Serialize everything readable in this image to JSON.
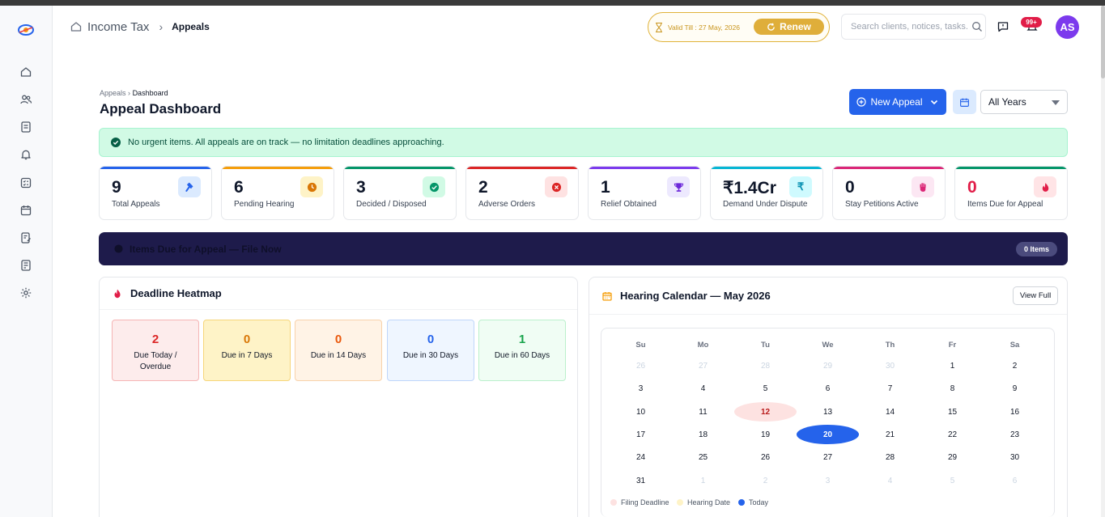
{
  "header": {
    "module": "Income Tax",
    "page": "Appeals",
    "validity": "Valid Till : 27 May, 2026",
    "renew_label": "Renew",
    "search_placeholder": "Search clients, notices, tasks...",
    "notification_count": "99+",
    "avatar_initials": "AS"
  },
  "page": {
    "breadcrumb_parent": "Appeals",
    "breadcrumb_current": "Dashboard",
    "title": "Appeal Dashboard",
    "new_appeal_label": "New Appeal",
    "year_filter": "All Years"
  },
  "alert": {
    "message": "No urgent items. All appeals are on track — no limitation deadlines approaching."
  },
  "stats": [
    {
      "value": "9",
      "label": "Total Appeals",
      "color": "#2563eb",
      "icon": "gavel-icon"
    },
    {
      "value": "6",
      "label": "Pending Hearing",
      "color": "#f59e0b",
      "icon": "clock-icon"
    },
    {
      "value": "3",
      "label": "Decided / Disposed",
      "color": "#059669",
      "icon": "check-circle-icon"
    },
    {
      "value": "2",
      "label": "Adverse Orders",
      "color": "#dc2626",
      "icon": "x-circle-icon"
    },
    {
      "value": "1",
      "label": "Relief Obtained",
      "color": "#7c3aed",
      "icon": "trophy-icon"
    },
    {
      "value": "₹1.4Cr",
      "label": "Demand Under Dispute",
      "color": "#06b6d4",
      "icon": "rupee-icon"
    },
    {
      "value": "0",
      "label": "Stay Petitions Active",
      "color": "#db2777",
      "icon": "hand-icon"
    },
    {
      "value": "0",
      "label": "Items Due for Appeal",
      "color": "#e11d48",
      "icon": "fire-icon"
    }
  ],
  "due_banner": {
    "title": "Items Due for Appeal — File Now",
    "count": "0 Items"
  },
  "heatmap": {
    "title": "Deadline Heatmap",
    "cells": [
      {
        "value": "2",
        "label": "Due Today / Overdue",
        "color": "#dc2626"
      },
      {
        "value": "0",
        "label": "Due in 7 Days",
        "color": "#d97706"
      },
      {
        "value": "0",
        "label": "Due in 14 Days",
        "color": "#ea580c"
      },
      {
        "value": "0",
        "label": "Due in 30 Days",
        "color": "#2563eb"
      },
      {
        "value": "1",
        "label": "Due in 60 Days",
        "color": "#16a34a"
      }
    ]
  },
  "calendar": {
    "title": "Hearing Calendar — May 2026",
    "view_full_label": "View Full",
    "weekdays": [
      "Su",
      "Mo",
      "Tu",
      "We",
      "Th",
      "Fr",
      "Sa"
    ],
    "days": [
      "26",
      "27",
      "28",
      "29",
      "30",
      "1",
      "2",
      "3",
      "4",
      "5",
      "6",
      "7",
      "8",
      "9",
      "10",
      "11",
      "12",
      "13",
      "14",
      "15",
      "16",
      "17",
      "18",
      "19",
      "20",
      "21",
      "22",
      "23",
      "24",
      "25",
      "26",
      "27",
      "28",
      "29",
      "30",
      "31",
      "1",
      "2",
      "3",
      "4",
      "5",
      "6"
    ],
    "legend": [
      "Filing Deadline",
      "Hearing Date",
      "Today"
    ]
  },
  "colors": {
    "primary": "#2563eb",
    "banner": "#1e1b4b",
    "success_bg": "#d1fae5",
    "gold": "#dfae3a"
  }
}
